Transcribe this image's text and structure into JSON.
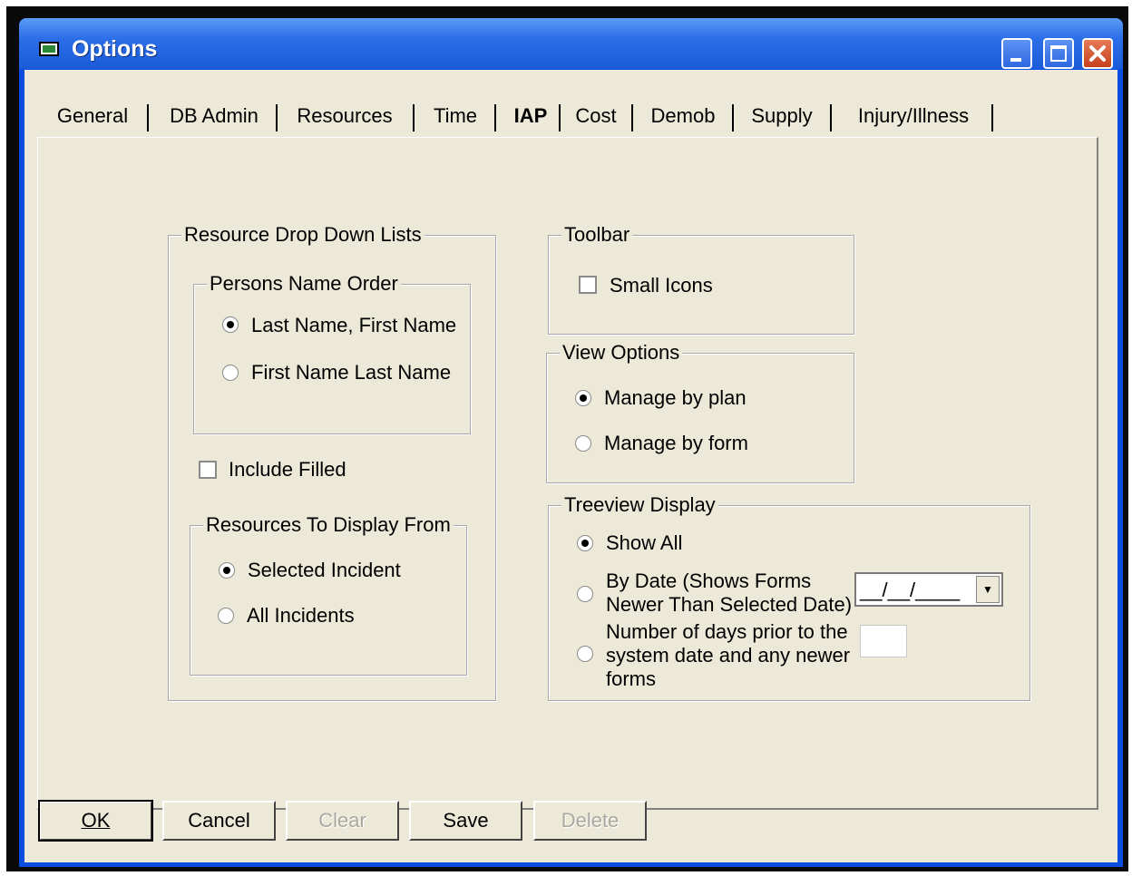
{
  "window": {
    "title": "Options"
  },
  "tabs": [
    {
      "label": "General"
    },
    {
      "label": "DB Admin"
    },
    {
      "label": "Resources"
    },
    {
      "label": "Time"
    },
    {
      "label": "IAP"
    },
    {
      "label": "Cost"
    },
    {
      "label": "Demob"
    },
    {
      "label": "Supply"
    },
    {
      "label": "Injury/Illness"
    }
  ],
  "active_tab": "IAP",
  "resource_lists": {
    "legend": "Resource Drop Down Lists",
    "name_order": {
      "legend": "Persons Name Order",
      "options": [
        {
          "label": "Last Name, First Name",
          "selected": true
        },
        {
          "label": "First Name Last Name",
          "selected": false
        }
      ]
    },
    "include_filled": {
      "label": "Include Filled",
      "checked": false
    },
    "display_from": {
      "legend": "Resources To Display From",
      "options": [
        {
          "label": "Selected Incident",
          "selected": true
        },
        {
          "label": "All Incidents",
          "selected": false
        }
      ]
    }
  },
  "toolbar": {
    "legend": "Toolbar",
    "small_icons": {
      "label": "Small Icons",
      "checked": false
    }
  },
  "view_options": {
    "legend": "View Options",
    "options": [
      {
        "label": "Manage by plan",
        "selected": true
      },
      {
        "label": "Manage by form",
        "selected": false
      }
    ]
  },
  "treeview": {
    "legend": "Treeview Display",
    "show_all": {
      "label": "Show All",
      "selected": true
    },
    "by_date": {
      "line1": "By Date (Shows Forms",
      "line2": "Newer Than Selected Date)",
      "selected": false,
      "date_value": "__/__/____"
    },
    "days_prior": {
      "line1": "Number of days prior to the",
      "line2": "system date and any newer",
      "line3": "forms",
      "selected": false,
      "value": ""
    }
  },
  "buttons": {
    "ok": "OK",
    "cancel": "Cancel",
    "clear": "Clear",
    "save": "Save",
    "delete": "Delete"
  }
}
